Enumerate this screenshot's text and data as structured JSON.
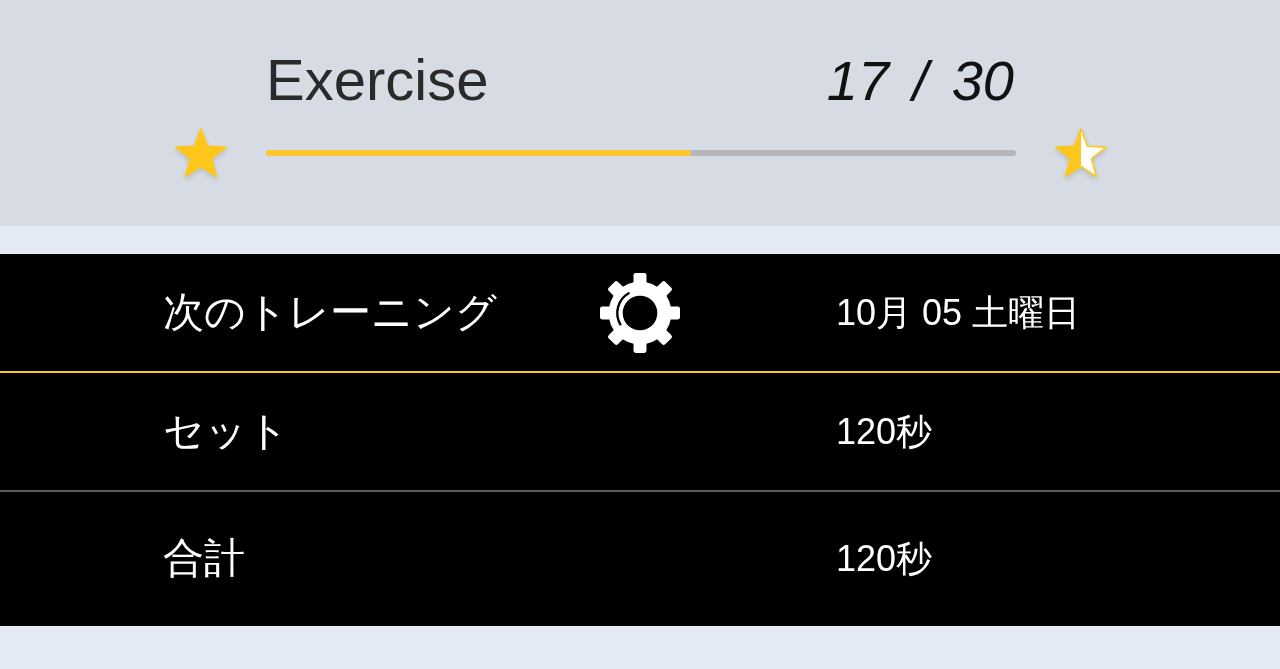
{
  "header": {
    "title": "Exercise",
    "progress": {
      "reading": "17 / 30",
      "level": 0.567
    },
    "milestones": [
      {
        "level": 1
      },
      {
        "level": 0.5
      }
    ]
  },
  "rows": [
    {
      "kind": "settings",
      "label": "次のトレーニング",
      "value": "10月 05 土曜日",
      "selected": true
    },
    {
      "kind": "plain",
      "label": "セット",
      "value": "120秒",
      "selected": false
    },
    {
      "kind": "plain",
      "label": "合計",
      "value": "120秒",
      "selected": false
    }
  ]
}
